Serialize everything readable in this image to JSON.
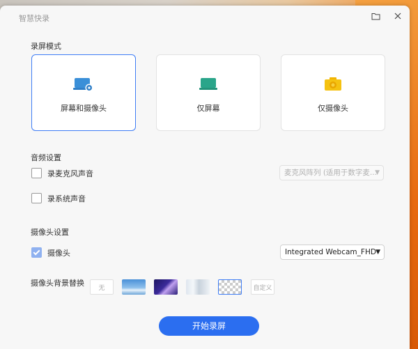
{
  "window": {
    "title": "智慧快录"
  },
  "record_mode": {
    "heading": "录屏模式",
    "options": [
      {
        "label": "屏幕和摄像头",
        "selected": true
      },
      {
        "label": "仅屏幕",
        "selected": false
      },
      {
        "label": "仅摄像头",
        "selected": false
      }
    ]
  },
  "audio": {
    "heading": "音频设置",
    "mic_label": "录麦克风声音",
    "mic_checked": false,
    "mic_select": "麦克风阵列 (适用于数字麦...",
    "system_label": "录系统声音",
    "system_checked": false
  },
  "camera": {
    "heading": "摄像头设置",
    "camera_label": "摄像头",
    "camera_checked": true,
    "camera_select": "Integrated Webcam_FHD",
    "bg_label": "摄像头背景替换",
    "bg_none": "无",
    "bg_custom": "自定义"
  },
  "start_button": "开始录屏",
  "colors": {
    "accent": "#2b6ef0",
    "selected_border": "#3d7cf5"
  }
}
